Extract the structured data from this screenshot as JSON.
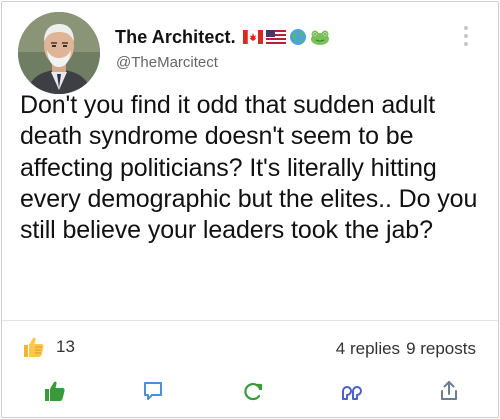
{
  "post": {
    "author": {
      "display_name": "The Architect.",
      "handle": "@TheMarcitect",
      "name_emojis": [
        "canada-flag-icon",
        "usa-flag-icon",
        "globe-icon",
        "frog-icon"
      ]
    },
    "body": "Don't you find it odd that sudden adult death syndrome doesn't seem to be affecting politicians? It's literally hitting every demographic but the elites.. Do you still believe your leaders took the jab?",
    "like_count": "13",
    "replies_text": "4 replies",
    "reposts_text": "9 reposts"
  },
  "actions": [
    "like-icon",
    "reply-icon",
    "repost-icon",
    "quote-icon",
    "share-icon"
  ],
  "colors": {
    "like_active": "#3a9a3a",
    "reply": "#4a90d9",
    "repost": "#3a9a3a",
    "quote": "#4a5fd0",
    "share": "#6a7f90"
  }
}
